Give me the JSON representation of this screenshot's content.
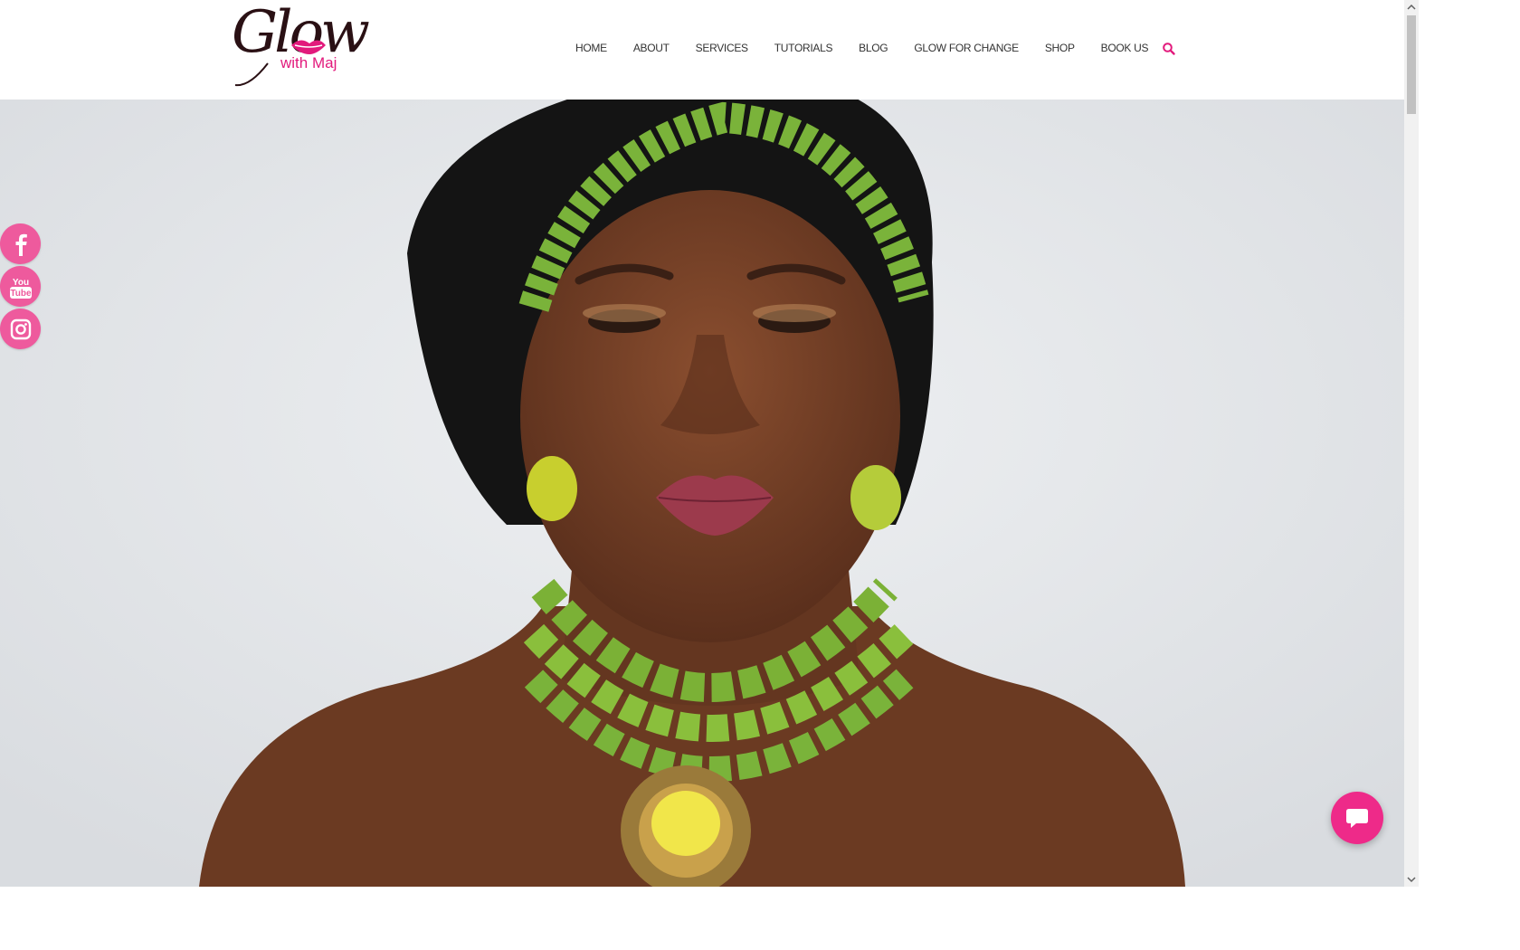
{
  "logo": {
    "script": "Glow",
    "sub": "with Maj"
  },
  "nav": {
    "items": [
      {
        "label": "HOME"
      },
      {
        "label": "ABOUT"
      },
      {
        "label": "SERVICES"
      },
      {
        "label": "TUTORIALS"
      },
      {
        "label": "BLOG"
      },
      {
        "label": "GLOW FOR CHANGE"
      },
      {
        "label": "SHOP"
      },
      {
        "label": "BOOK US"
      }
    ]
  },
  "icons": {
    "search": "search-icon",
    "facebook": "facebook-icon",
    "youtube": "youtube-icon",
    "instagram": "instagram-icon",
    "chat": "chat-icon"
  },
  "social": {
    "youtube_top": "You",
    "youtube_bottom": "Tube"
  },
  "colors": {
    "brand_pink": "#e21a7c",
    "social_pink": "#ee5a9d",
    "chat_pink": "#ee2a89",
    "nav_text": "#333333",
    "hero_bg": "#e3e5e8"
  }
}
